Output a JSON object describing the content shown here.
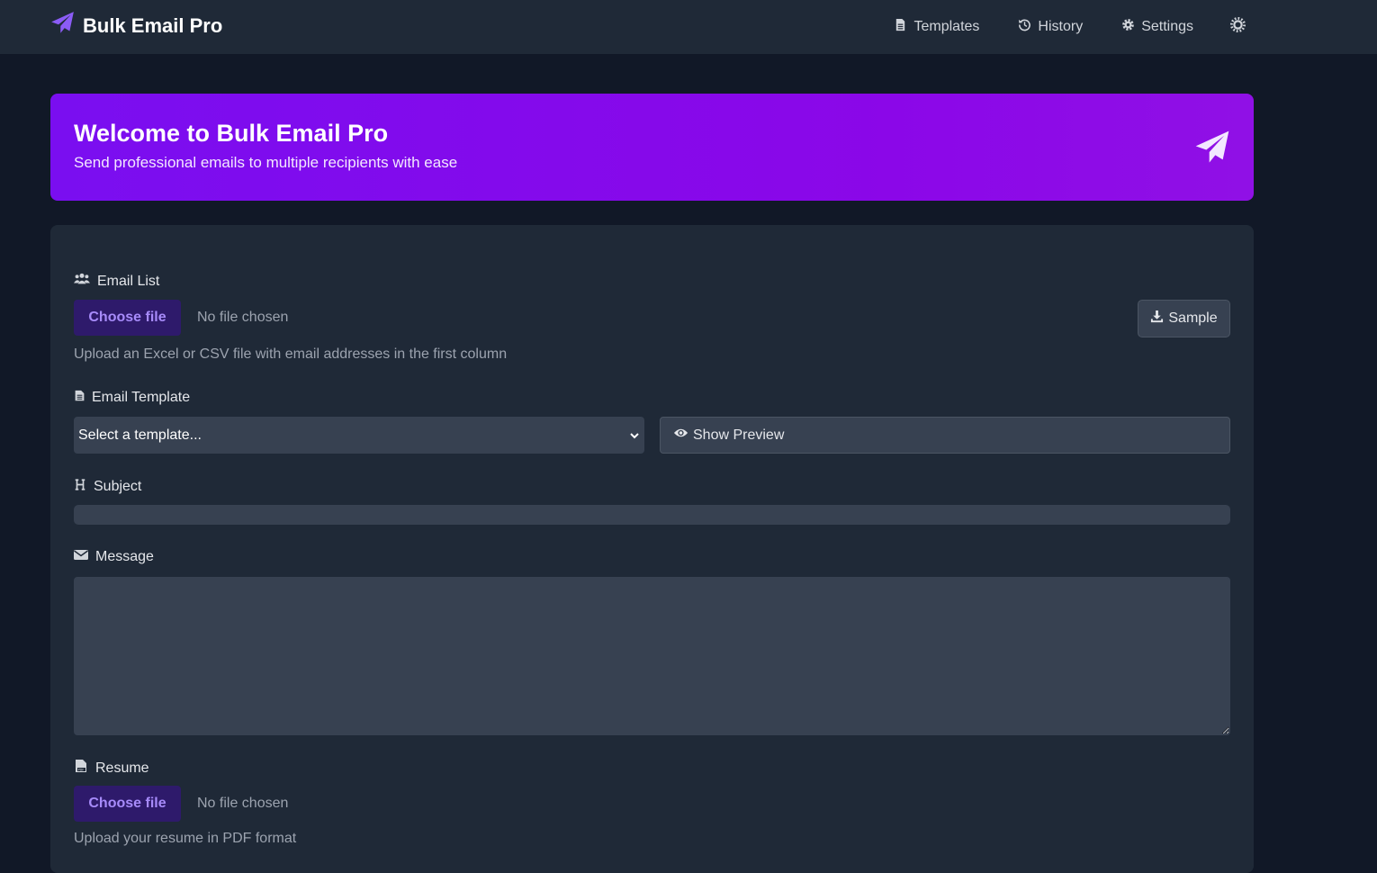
{
  "app": {
    "title": "Bulk Email Pro"
  },
  "nav": {
    "items": [
      {
        "label": "Templates",
        "icon": "file-icon"
      },
      {
        "label": "History",
        "icon": "history-icon"
      },
      {
        "label": "Settings",
        "icon": "gear-icon"
      }
    ],
    "theme_icon": "sun-icon"
  },
  "hero": {
    "title": "Welcome to Bulk Email Pro",
    "subtitle": "Send professional emails to multiple recipients with ease",
    "icon": "paper-plane-icon"
  },
  "form": {
    "email_list": {
      "label": "Email List",
      "button_label": "Choose file",
      "file_status": "No file chosen",
      "help": "Upload an Excel or CSV file with email addresses in the first column",
      "sample_label": "Sample"
    },
    "template": {
      "label": "Email Template",
      "selected": "Select a template...",
      "preview_label": "Show Preview"
    },
    "subject": {
      "label": "Subject",
      "value": ""
    },
    "message": {
      "label": "Message",
      "value": ""
    },
    "resume": {
      "label": "Resume",
      "button_label": "Choose file",
      "file_status": "No file chosen",
      "help": "Upload your resume in PDF format"
    }
  },
  "colors": {
    "page_bg": "#111827",
    "panel_bg": "#1f2937",
    "accent": "#8b5cf6",
    "hero_gradient_start": "#7a0ef0",
    "hero_gradient_end": "#9010e6"
  }
}
